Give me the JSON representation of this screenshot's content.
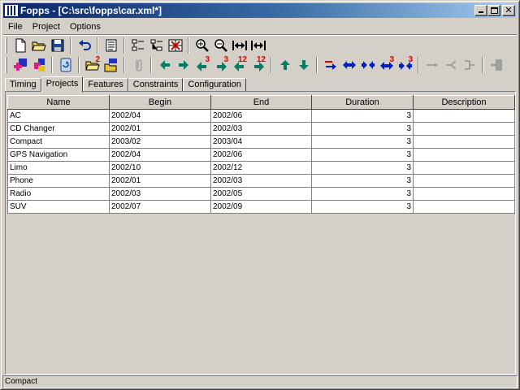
{
  "window": {
    "title": "Fopps - [C:\\src\\fopps\\car.xml*]"
  },
  "menu": [
    "File",
    "Project",
    "Options"
  ],
  "toolbar1": [
    "new-file-icon",
    "open-folder-icon",
    "save-icon",
    "|",
    "undo-icon",
    "|",
    "properties-list-icon",
    "|",
    "list-view-icon",
    "tree-view-icon",
    "grid-remove-icon",
    "|",
    "zoom-in-icon",
    "zoom-out-icon",
    "fit-width-icon",
    "expand-width-icon"
  ],
  "toolbar2": [
    {
      "icon": "add-feature-icon"
    },
    {
      "icon": "add-constraint-icon"
    },
    {
      "sep": true
    },
    {
      "icon": "refresh-icon"
    },
    {
      "sep": true
    },
    {
      "icon": "open-folder-2-icon",
      "badge": "2"
    },
    {
      "icon": "import-icon"
    },
    {
      "sep": true
    },
    {
      "icon": "attach-icon"
    },
    {
      "sep": true
    },
    {
      "icon": "arrow-left-icon"
    },
    {
      "icon": "arrow-right-icon"
    },
    {
      "icon": "arrow-left-3-icon",
      "badge": "3"
    },
    {
      "icon": "arrow-right-3-icon",
      "badge": "3"
    },
    {
      "icon": "arrow-left-12-icon",
      "badge": "12"
    },
    {
      "icon": "arrow-right-12-icon",
      "badge": "12"
    },
    {
      "sep": true
    },
    {
      "icon": "arrow-up-icon"
    },
    {
      "icon": "arrow-down-icon"
    },
    {
      "sep": true
    },
    {
      "icon": "insert-row-icon"
    },
    {
      "icon": "expand-both-icon"
    },
    {
      "icon": "collapse-both-icon"
    },
    {
      "icon": "expand-3-icon",
      "badge": "3"
    },
    {
      "icon": "collapse-3-icon",
      "badge": "3"
    },
    {
      "sep": true
    },
    {
      "icon": "link-arrow-icon"
    },
    {
      "icon": "branch-icon"
    },
    {
      "icon": "merge-icon"
    },
    {
      "sep": true
    },
    {
      "icon": "exit-icon"
    }
  ],
  "tabs": [
    {
      "label": "Timing",
      "active": false
    },
    {
      "label": "Projects",
      "active": true
    },
    {
      "label": "Features",
      "active": false
    },
    {
      "label": "Constraints",
      "active": false
    },
    {
      "label": "Configuration",
      "active": false
    }
  ],
  "table": {
    "columns": [
      "Name",
      "Begin",
      "End",
      "Duration",
      "Description"
    ],
    "rows": [
      [
        "AC",
        "2002/04",
        "2002/06",
        "3",
        ""
      ],
      [
        "CD Changer",
        "2002/01",
        "2002/03",
        "3",
        ""
      ],
      [
        "Compact",
        "2003/02",
        "2003/04",
        "3",
        ""
      ],
      [
        "GPS Navigation",
        "2002/04",
        "2002/06",
        "3",
        ""
      ],
      [
        "Limo",
        "2002/10",
        "2002/12",
        "3",
        ""
      ],
      [
        "Phone",
        "2002/01",
        "2002/03",
        "3",
        ""
      ],
      [
        "Radio",
        "2002/03",
        "2002/05",
        "3",
        ""
      ],
      [
        "SUV",
        "2002/07",
        "2002/09",
        "3",
        ""
      ]
    ]
  },
  "status": {
    "text": "Compact"
  },
  "colors": {
    "title_start": "#0a246a",
    "title_end": "#a6caf0",
    "face": "#d4d0c8",
    "arrow_green": "#008060",
    "arrow_blue": "#0020c0",
    "badge_red": "#e00000"
  }
}
